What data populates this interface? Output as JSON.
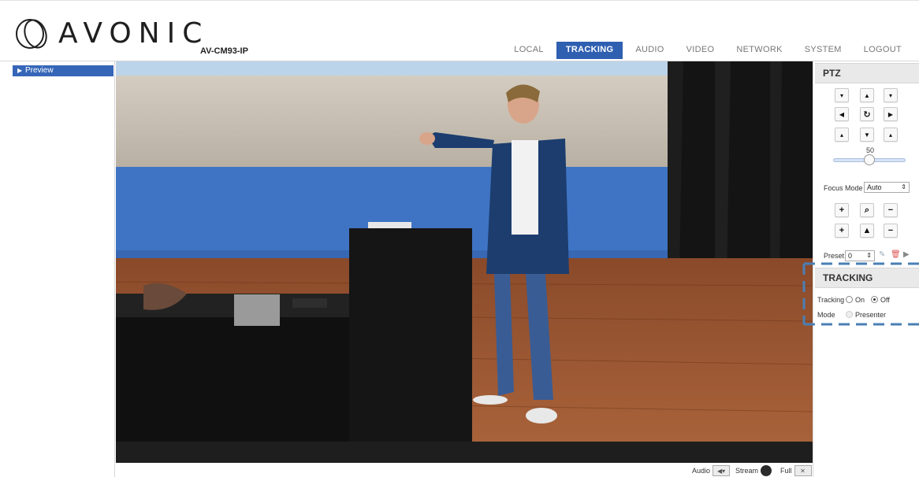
{
  "header": {
    "logo_text": "AVONIC",
    "model": "AV-CM93-IP",
    "nav": [
      {
        "label": "LOCAL",
        "active": false
      },
      {
        "label": "TRACKING",
        "active": true
      },
      {
        "label": "AUDIO",
        "active": false
      },
      {
        "label": "VIDEO",
        "active": false
      },
      {
        "label": "NETWORK",
        "active": false
      },
      {
        "label": "SYSTEM",
        "active": false
      },
      {
        "label": "LOGOUT",
        "active": false
      }
    ]
  },
  "sidebar": {
    "items": [
      {
        "label": "Preview",
        "active": true
      }
    ]
  },
  "video_controls": {
    "audio_label": "Audio",
    "stream_label": "Stream",
    "full_label": "Full"
  },
  "ptz": {
    "title": "PTZ",
    "speed_value": "50",
    "speed_level": 0.5,
    "focus_mode_label": "Focus Mode",
    "focus_mode_value": "Auto",
    "preset_label": "Preset",
    "preset_value": "0"
  },
  "tracking": {
    "title": "TRACKING",
    "tracking_label": "Tracking",
    "on_label": "On",
    "off_label": "Off",
    "selected": "Off",
    "mode_label": "Mode",
    "mode_value": "Presenter"
  },
  "colors": {
    "accent": "#2f5fb1",
    "dashed_highlight": "#4a7fb5"
  }
}
